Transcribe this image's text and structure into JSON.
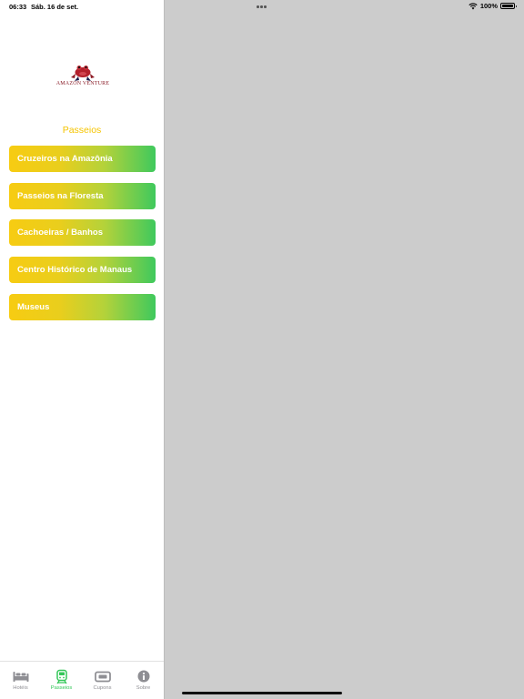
{
  "status_bar": {
    "time": "06:33",
    "date": "Sáb. 16 de set.",
    "battery": "100%"
  },
  "logo": {
    "text": "AMAZON VENTURE",
    "icon": "frog-icon"
  },
  "sidebar": {
    "title": "Passeios",
    "items": [
      {
        "label": "Cruzeiros na Amazônia"
      },
      {
        "label": "Passeios na Floresta"
      },
      {
        "label": "Cachoeiras / Banhos"
      },
      {
        "label": "Centro Histórico de Manaus"
      },
      {
        "label": "Museus"
      }
    ]
  },
  "tabs": [
    {
      "label": "Hotéis",
      "icon": "bed-icon",
      "active": false
    },
    {
      "label": "Passeios",
      "icon": "tram-icon",
      "active": true
    },
    {
      "label": "Cupons",
      "icon": "ticket-icon",
      "active": false
    },
    {
      "label": "Sobre",
      "icon": "info-icon",
      "active": false
    }
  ],
  "colors": {
    "accent_yellow": "#f5c400",
    "accent_green": "#34c759",
    "gradient_start": "#f7cc12",
    "gradient_end": "#3fc95d",
    "inactive_gray": "#8e8e93",
    "detail_background": "#cccccc"
  }
}
